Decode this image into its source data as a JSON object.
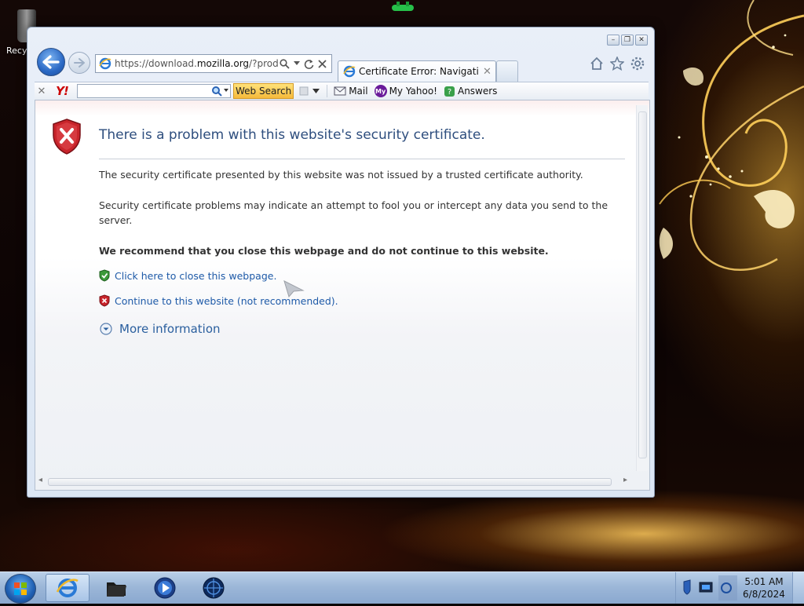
{
  "desktop": {
    "recycle_label": "Recy"
  },
  "window": {
    "controls": {
      "minimize": "–",
      "restore": "❐",
      "close": "✕"
    }
  },
  "address": {
    "url_prefix": "https://download.",
    "url_domain": "mozilla.org",
    "url_suffix": "/?product"
  },
  "tab": {
    "title": "Certificate Error: Navigatio...",
    "close": "✕"
  },
  "yahoo_toolbar": {
    "close": "✕",
    "logo": "Y!",
    "web_search_label": "Web Search",
    "mail_label": "Mail",
    "my_yahoo_badge": "My",
    "my_yahoo_label": "My Yahoo!",
    "answers_label": "Answers"
  },
  "page": {
    "heading": "There is a problem with this website's security certificate.",
    "paragraph_1": "The security certificate presented by this website was not issued by a trusted certificate authority.",
    "paragraph_2": "Security certificate problems may indicate an attempt to fool you or intercept any data you send to the server.",
    "recommendation": "We recommend that you close this webpage and do not continue to this website.",
    "close_link": "Click here to close this webpage.",
    "continue_link": "Continue to this website (not recommended).",
    "more_info": "More information"
  },
  "taskbar": {
    "time": "5:01 AM",
    "date": "6/8/2024"
  },
  "colors": {
    "heading": "#2e4e7e",
    "link": "#1e5aa8",
    "shield_red": "#c8242b",
    "shield_green": "#3c9a3a"
  }
}
